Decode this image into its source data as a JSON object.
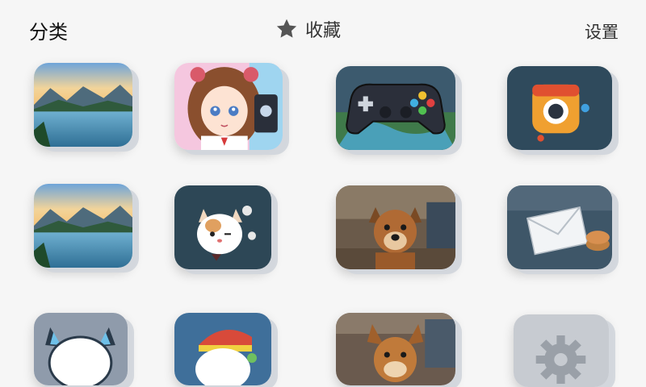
{
  "nav": {
    "left_label": "分类",
    "center_label": "收藏",
    "right_label": "设置"
  },
  "tiles": [
    {
      "name": "lake-landscape-app-icon"
    },
    {
      "name": "anime-girl-app-icon"
    },
    {
      "name": "game-controller-app-icon"
    },
    {
      "name": "orange-camera-app-icon"
    },
    {
      "name": "lake-landscape-app-icon-2"
    },
    {
      "name": "cat-mascot-app-icon"
    },
    {
      "name": "dog-photo-app-icon"
    },
    {
      "name": "mail-envelope-app-icon"
    },
    {
      "name": "white-cat-app-icon"
    },
    {
      "name": "cat-red-hat-app-icon"
    },
    {
      "name": "puppy-app-icon"
    },
    {
      "name": "settings-gear-app-icon"
    }
  ],
  "colors": {
    "background": "#f6f6f6",
    "text": "#222222",
    "star": "#555555"
  }
}
